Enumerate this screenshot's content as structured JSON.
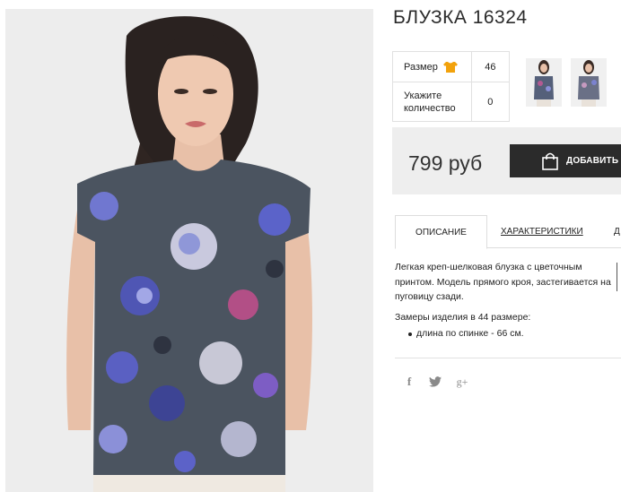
{
  "product": {
    "title": "БЛУЗКА 16324"
  },
  "options": {
    "size_label": "Размер",
    "size_value": "46",
    "quantity_label": "Укажите количество",
    "quantity_value": "0"
  },
  "pricing": {
    "price": "799 руб",
    "buy_label": "ДОБАВИТЬ В"
  },
  "tabs": [
    {
      "label": "ОПИСАНИЕ",
      "active": true
    },
    {
      "label": "ХАРАКТЕРИСТИКИ",
      "active": false
    },
    {
      "label": "Д",
      "active": false
    }
  ],
  "description": {
    "text": "Легкая креп-шелковая блузка с цветочным принтом. Модель прямого кроя, застегивается на пуговицу сзади.",
    "measures_title": "Замеры изделия в 44 размере:",
    "measures": [
      "длина по спинке - 66 см."
    ]
  },
  "social": {
    "facebook": "f",
    "twitter": "t",
    "google_plus": "g+"
  },
  "icons": {
    "size_chart": "tshirt-icon",
    "cart": "shopping-bag-icon",
    "facebook": "facebook-icon",
    "twitter": "twitter-icon",
    "google_plus": "google-plus-icon"
  },
  "colors": {
    "size_icon": "#f2a20c",
    "buy_button": "#2b2b2b",
    "price_panel": "#eeeeee"
  }
}
